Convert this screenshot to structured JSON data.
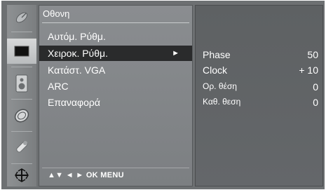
{
  "menu": {
    "title": "Οθονη",
    "items": [
      {
        "label": "Αυτόμ. Ρύθμ."
      },
      {
        "label": "Χειροκ. Ρύθμ.",
        "selected": true,
        "arrow": "►"
      },
      {
        "label": "Κατάστ. VGA"
      },
      {
        "label": "ARC"
      },
      {
        "label": "Επαναφορά"
      }
    ],
    "hint": "▲▼  ◄ ►  OK  MENU"
  },
  "submenu": {
    "rows": [
      {
        "label": "Phase",
        "value": "50"
      },
      {
        "label": "Clock",
        "value": "+ 10"
      },
      {
        "label": "Ορ. θέση",
        "value": "0"
      },
      {
        "label": "Καθ. θεση",
        "value": "0"
      }
    ]
  },
  "sidebar_icons": [
    {
      "name": "satellite-icon"
    },
    {
      "name": "screen-icon",
      "selected": true
    },
    {
      "name": "speaker-icon"
    },
    {
      "name": "clock-icon"
    },
    {
      "name": "key-icon"
    },
    {
      "name": "input-icon"
    }
  ],
  "colors": {
    "panel": "#7c7f82",
    "selected": "#2a2b2c",
    "subpanel": "#606365"
  }
}
